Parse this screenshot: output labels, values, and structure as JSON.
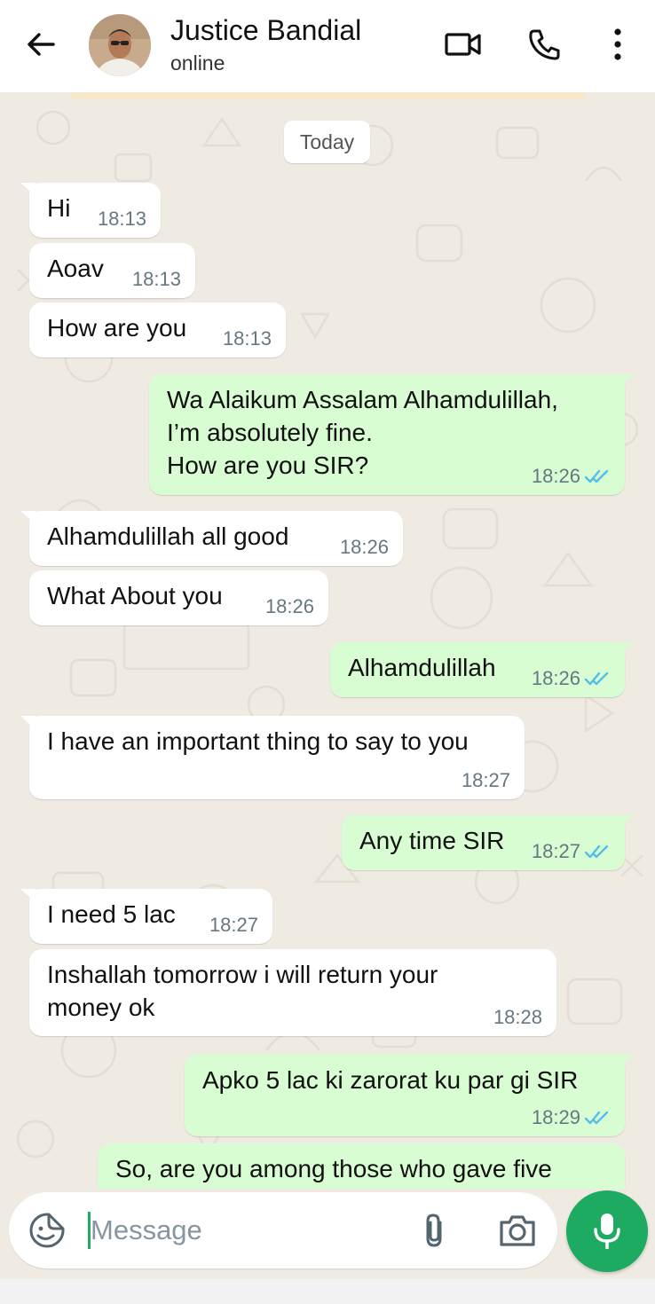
{
  "header": {
    "contact_name": "Justice Bandial",
    "status": "online",
    "icons": [
      "back-arrow-icon",
      "video-call-icon",
      "voice-call-icon",
      "more-options-icon"
    ]
  },
  "chat": {
    "date_chip": "Today",
    "messages": [
      {
        "direction": "incoming",
        "text": "Hi",
        "time": "18:13"
      },
      {
        "direction": "incoming",
        "text": "Aoav",
        "time": "18:13"
      },
      {
        "direction": "incoming",
        "text": "How are you",
        "time": "18:13"
      },
      {
        "direction": "outgoing",
        "text": "Wa Alaikum Assalam Alhamdulillah,\nI’m absolutely fine.\nHow are you SIR?",
        "time": "18:26",
        "read": true
      },
      {
        "direction": "incoming",
        "text": "Alhamdulillah all good",
        "time": "18:26"
      },
      {
        "direction": "incoming",
        "text": "What About you",
        "time": "18:26"
      },
      {
        "direction": "outgoing",
        "text": "Alhamdulillah",
        "time": "18:26",
        "read": true
      },
      {
        "direction": "incoming",
        "text": "I have an important thing to say to you",
        "time": "18:27"
      },
      {
        "direction": "outgoing",
        "text": "Any time SIR",
        "time": "18:27",
        "read": true
      },
      {
        "direction": "incoming",
        "text": "I need 5 lac",
        "time": "18:27"
      },
      {
        "direction": "incoming",
        "text": "Inshallah tomorrow i will return your\nmoney ok",
        "time": "18:28"
      },
      {
        "direction": "outgoing",
        "text": "Apko 5 lac ki zarorat ku par gi SIR",
        "time": "18:29",
        "read": true
      },
      {
        "direction": "outgoing",
        "text": "So, are you among those who gave five",
        "time": "",
        "read": false
      }
    ]
  },
  "composer": {
    "placeholder": "Message",
    "value": ""
  },
  "colors": {
    "incoming_bubble": "#ffffff",
    "outgoing_bubble": "#d9fdd3",
    "wallpaper": "#efeae2",
    "accent_green": "#1daa61",
    "read_tick_blue": "#53bdeb"
  }
}
